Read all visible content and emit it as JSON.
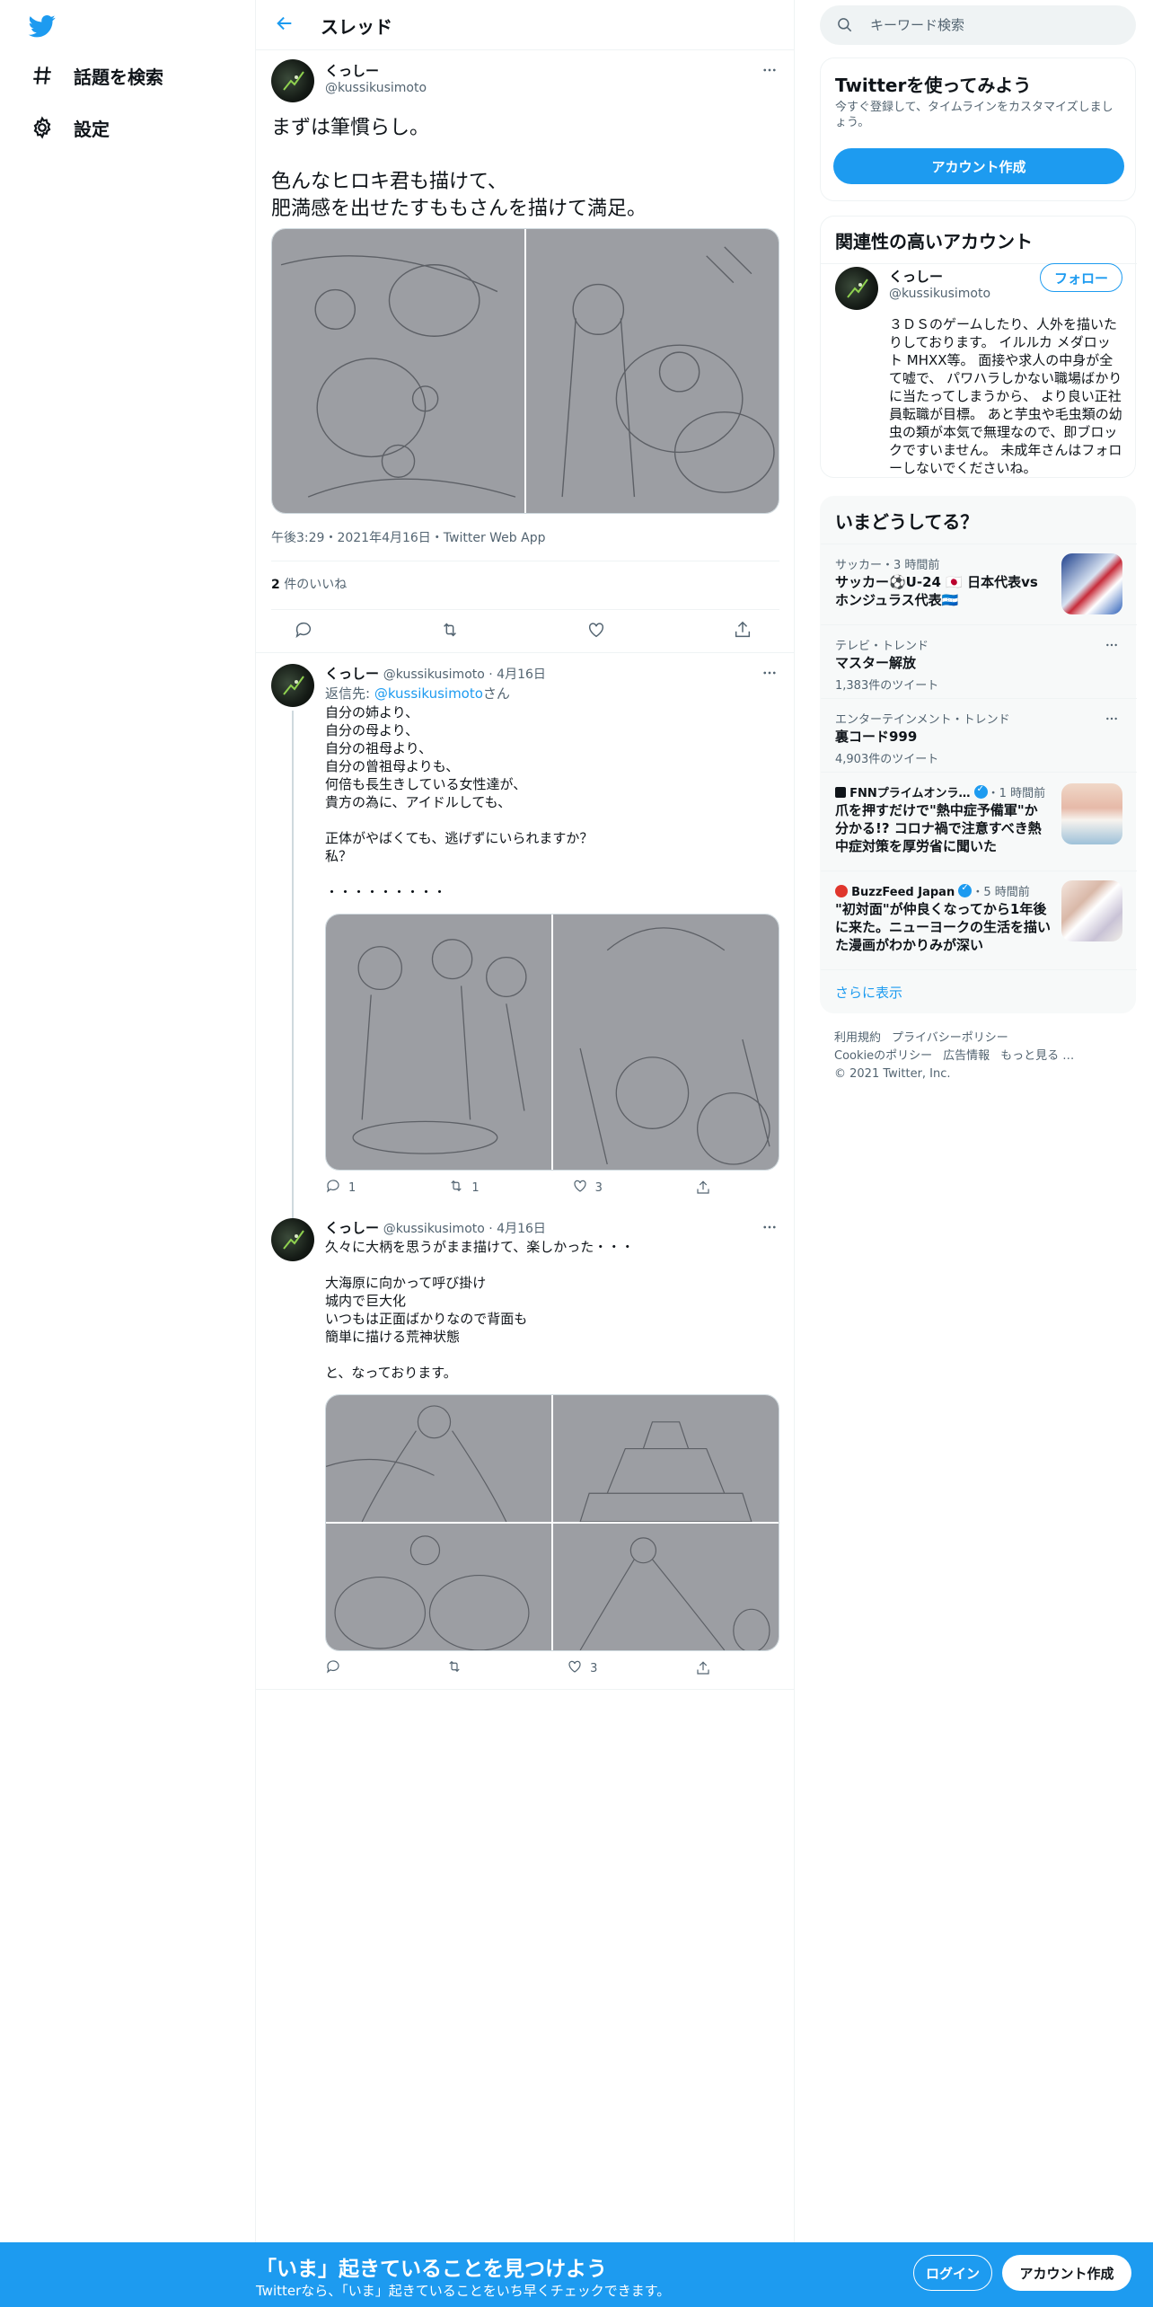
{
  "colors": {
    "brand": "#1d9bf0",
    "text": "#0f1419",
    "muted": "#536471",
    "border": "#eff3f4"
  },
  "nav": {
    "logo_icon": "twitter-bird-icon",
    "items": [
      {
        "label": "話題を検索",
        "icon": "hashtag-icon"
      },
      {
        "label": "設定",
        "icon": "gear-icon"
      }
    ]
  },
  "header": {
    "title": "スレッド",
    "back_icon": "arrow-left-icon"
  },
  "main_tweet": {
    "name": "くっしー",
    "handle": "@kussikusimoto",
    "text": "まずは筆慣らし。\n\n色んなヒロキ君も描けて、\n肥満感を出せたすももさんを描けて満足。",
    "meta": "午後3:29・2021年4月16日・Twitter Web App",
    "likes_count": "2",
    "likes_label": " 件のいいね",
    "image_count": 2
  },
  "replies": [
    {
      "name": "くっしー",
      "handle_date": "@kussikusimoto · 4月16日",
      "reply_prefix": "返信先: ",
      "reply_handle": "@kussikusimoto",
      "reply_suffix": "さん",
      "text": "自分の姉より、\n自分の母より、\n自分の祖母より、\n自分の曾祖母よりも、\n何倍も長生きしている女性達が、\n貴方の為に、アイドルしても、\n\n正体がやばくても、逃げずにいられますか？\n私？\n\n・・・・・・・・・",
      "replies": "1",
      "retweets": "1",
      "likes": "3",
      "image_count": 2
    },
    {
      "name": "くっしー",
      "handle_date": "@kussikusimoto · 4月16日",
      "text": "久々に大柄を思うがまま描けて、楽しかった・・・\n\n大海原に向かって呼び掛け\n城内で巨大化\nいつもは正面ばかりなので背面も\n簡単に描ける荒神状態\n\nと、なっております。",
      "replies": "",
      "retweets": "",
      "likes": "3",
      "image_count": 4
    }
  ],
  "search": {
    "placeholder": "キーワード検索"
  },
  "signup_card": {
    "title": "Twitterを使ってみよう",
    "desc": "今すぐ登録して、タイムラインをカスタマイズしましょう。",
    "button": "アカウント作成"
  },
  "related": {
    "title": "関連性の高いアカウント",
    "name": "くっしー",
    "handle": "@kussikusimoto",
    "follow": "フォロー",
    "bio": "３ＤＳのゲームしたり、人外を描いたりしております。 イルルカ メダロット MHXX等。 面接や求人の中身が全て嘘で、 パワハラしかない職場ばかりに当たってしまうから、 より良い正社員転職が目標。 あと芋虫や毛虫類の幼虫の類が本気で無理なので、即ブロックですいません。 未成年さんはフォローしないでくださいね。"
  },
  "trends": {
    "title": "いまどうしてる？",
    "items": [
      {
        "context": "サッカー・3 時間前",
        "title": "サッカー⚽U-24 🇯🇵 日本代表vsホンジュラス代表🇭🇳",
        "sub": ""
      },
      {
        "context": "テレビ・トレンド",
        "title": "マスター解放",
        "sub": "1,383件のツイート"
      },
      {
        "context": "エンターテインメント・トレンド",
        "title": "裏コード999",
        "sub": "4,903件のツイート"
      },
      {
        "context_name": "FNNプライムオンラ…",
        "context_time": "・1 時間前",
        "title": "爪を押すだけで\"熱中症予備軍\"か分かる!? コロナ禍で注意すべき熱中症対策を厚労省に聞いた",
        "sub": ""
      },
      {
        "context_name": "BuzzFeed Japan",
        "context_time": "・5 時間前",
        "title": "\"初対面\"が仲良くなってから1年後に来た。ニューヨークの生活を描いた漫画がわかりみが深い",
        "sub": ""
      }
    ],
    "show_more": "さらに表示"
  },
  "footer": {
    "row1": [
      "利用規約",
      "プライバシーポリシー"
    ],
    "row2": [
      "Cookieのポリシー",
      "広告情報",
      "もっと見る …"
    ],
    "copyright": "© 2021 Twitter, Inc."
  },
  "bottom_bar": {
    "title": "「いま」起きていることを見つけよう",
    "subtitle": "Twitterなら、「いま」起きていることをいち早くチェックできます。",
    "login": "ログイン",
    "signup": "アカウント作成"
  }
}
